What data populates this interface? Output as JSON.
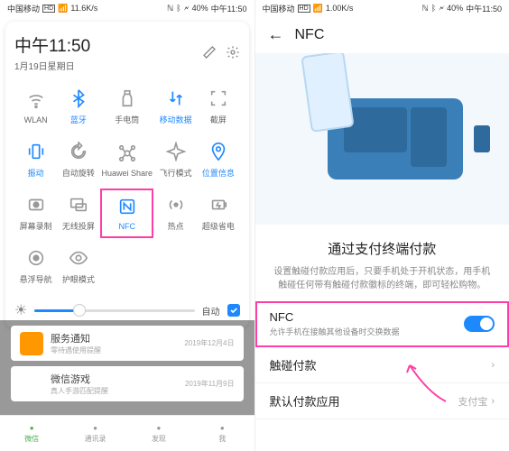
{
  "left": {
    "status": {
      "carrier": "中国移动",
      "net": "11.6K/s",
      "batt": "40%",
      "time": "中午11:50"
    },
    "panel_time": "中午11:50",
    "panel_date": "1月19日星期日",
    "tiles": [
      {
        "label": "WLAN",
        "active": false,
        "icon": "wifi"
      },
      {
        "label": "蓝牙",
        "active": true,
        "icon": "bluetooth"
      },
      {
        "label": "手电筒",
        "active": false,
        "icon": "flashlight"
      },
      {
        "label": "移动数据",
        "active": true,
        "icon": "data"
      },
      {
        "label": "截屏",
        "active": false,
        "icon": "screenshot"
      },
      {
        "label": "振动",
        "active": true,
        "icon": "vibrate"
      },
      {
        "label": "自动旋转",
        "active": false,
        "icon": "rotate"
      },
      {
        "label": "Huawei Share",
        "active": false,
        "icon": "share"
      },
      {
        "label": "飞行模式",
        "active": false,
        "icon": "airplane"
      },
      {
        "label": "位置信息",
        "active": true,
        "icon": "location"
      },
      {
        "label": "屏幕录制",
        "active": false,
        "icon": "record"
      },
      {
        "label": "无线投屏",
        "active": false,
        "icon": "cast"
      },
      {
        "label": "NFC",
        "active": true,
        "icon": "nfc",
        "hl": true
      },
      {
        "label": "热点",
        "active": false,
        "icon": "hotspot"
      },
      {
        "label": "超级省电",
        "active": false,
        "icon": "battery"
      },
      {
        "label": "悬浮导航",
        "active": false,
        "icon": "floatnav"
      },
      {
        "label": "护眼模式",
        "active": false,
        "icon": "eye"
      }
    ],
    "brightness": {
      "auto_label": "自动",
      "checked": true
    },
    "notifs": [
      {
        "title": "服务通知",
        "sub": "零待遇使用提醒",
        "date": "2019年12月4日",
        "color": "#ff9800"
      },
      {
        "title": "微信游戏",
        "sub": "真人手游匹配提醒",
        "date": "2019年11月9日",
        "color": "#fff"
      }
    ],
    "nav": [
      {
        "label": "微信",
        "on": true
      },
      {
        "label": "通讯录",
        "on": false
      },
      {
        "label": "发现",
        "on": false
      },
      {
        "label": "我",
        "on": false
      }
    ]
  },
  "right": {
    "status": {
      "carrier": "中国移动",
      "net": "1.00K/s",
      "batt": "40%",
      "time": "中午11:50"
    },
    "header_title": "NFC",
    "section_title": "通过支付终端付款",
    "section_desc": "设置触碰付款应用后，只要手机处于开机状态，用手机触碰任何带有触碰付款徽标的终端，即可轻松购物。",
    "settings": [
      {
        "name": "NFC",
        "desc": "允许手机在接触其他设备时交换数据",
        "type": "toggle",
        "hl": true
      },
      {
        "name": "触碰付款",
        "type": "link"
      },
      {
        "name": "默认付款应用",
        "value": "支付宝",
        "type": "link"
      }
    ]
  }
}
